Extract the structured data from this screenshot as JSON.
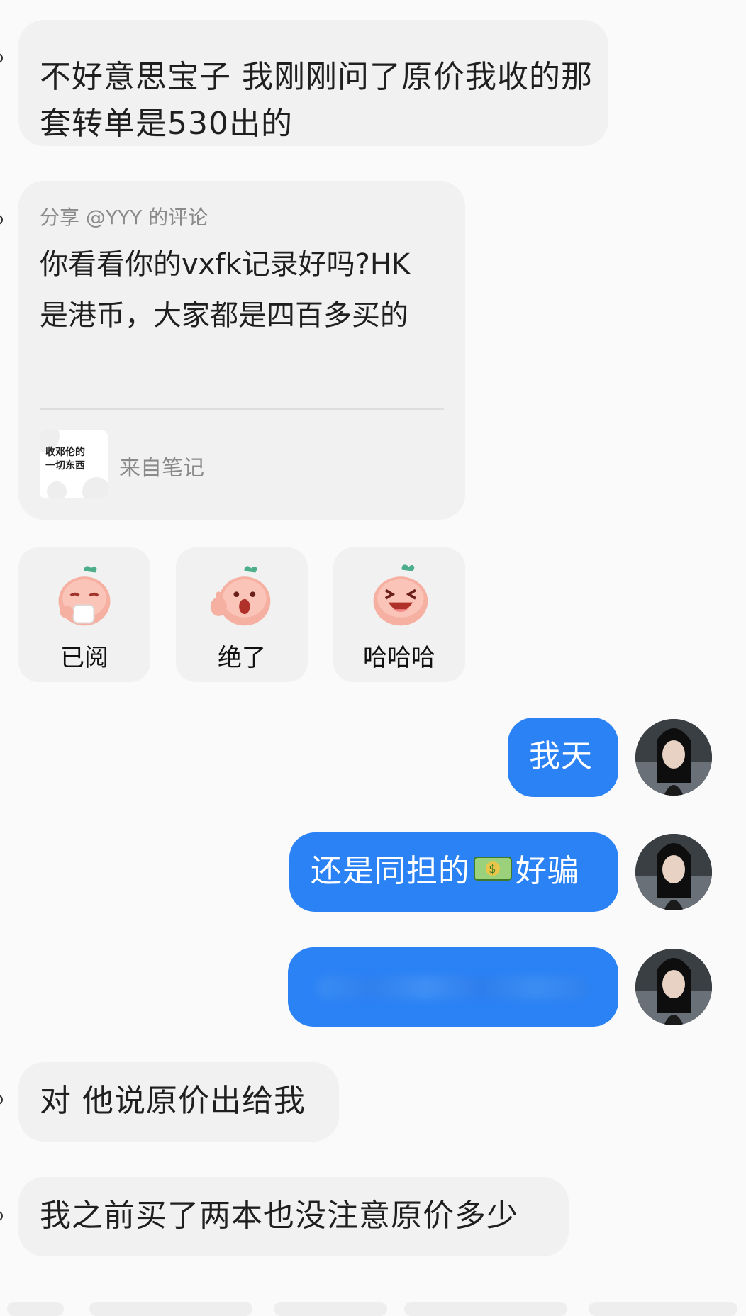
{
  "messages": {
    "m1": {
      "text": "不好意思宝子 我刚刚问了原价我收的那套转单是530出的"
    },
    "share": {
      "header": "分享 @YYY 的评论",
      "body": "你看看你的vxfk记录好吗?HK是港币，大家都是四百多买的",
      "thumb_line1": "收邓伦的",
      "thumb_line2": "一切东西",
      "source": "来自笔记"
    },
    "m4": {
      "text": "对 他说原价出给我"
    },
    "m5": {
      "text": "我之前买了两本也没注意原价多少"
    }
  },
  "reactions": [
    {
      "label": "已阅",
      "icon": "peach-drinking-tea-sticker"
    },
    {
      "label": "绝了",
      "icon": "peach-thumbs-up-sticker"
    },
    {
      "label": "哈哈哈",
      "icon": "peach-laughing-sticker"
    }
  ],
  "outgoing": {
    "o1": {
      "text": "我天"
    },
    "o2": {
      "before": "还是同担的",
      "emoji": "money-bag-emoji",
      "after": "好骗"
    },
    "o3": {
      "text": ""
    }
  },
  "colors": {
    "outgoing_bubble": "#2a82f5",
    "incoming_bubble": "#f1f1f1",
    "background": "#fafafa"
  }
}
